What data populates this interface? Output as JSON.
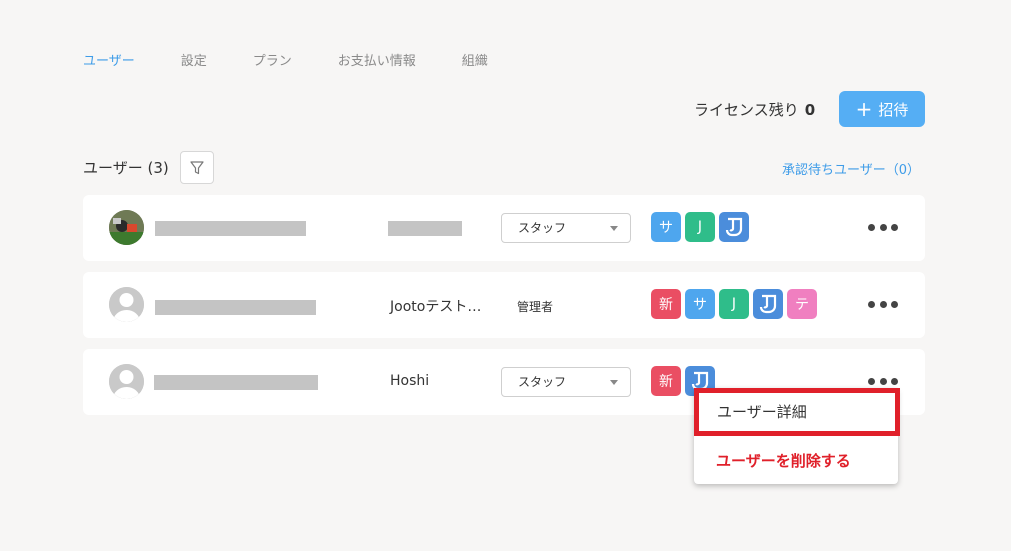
{
  "tabs": [
    {
      "label": "ユーザー"
    },
    {
      "label": "設定"
    },
    {
      "label": "プラン"
    },
    {
      "label": "お支払い情報"
    },
    {
      "label": "組織"
    }
  ],
  "license": {
    "label": "ライセンス残り",
    "count": "0"
  },
  "invite_button": {
    "icon": "+",
    "label": "招待"
  },
  "users_title": "ユーザー (3)",
  "pending_link": "承認待ちユーザー（0）",
  "users": [
    {
      "group": "",
      "role": "スタッフ",
      "badges": [
        "サ",
        "J",
        ""
      ]
    },
    {
      "group": "Jootoテスト…",
      "role": "管理者",
      "badges": [
        "新",
        "サ",
        "J",
        "",
        "テ"
      ]
    },
    {
      "group": "Hoshi",
      "role": "スタッフ",
      "badges": [
        "新",
        ""
      ]
    }
  ],
  "context_menu": {
    "detail": "ユーザー詳細",
    "delete": "ユーザーを削除する"
  },
  "colors": {
    "accent": "#55aef4",
    "danger": "#e0202a",
    "badge_new": "#ea4e63",
    "badge_sa": "#4ea6ee",
    "badge_j": "#2fbd8a",
    "badge_te": "#f07fc0",
    "badge_jooto": "#4b8ddb"
  }
}
